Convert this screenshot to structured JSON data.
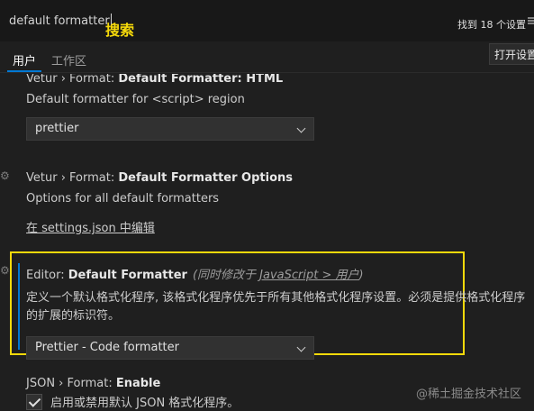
{
  "search": {
    "value": "default formatter",
    "annotation": "搜索",
    "result_count": "找到 18 个设置"
  },
  "tabs": [
    {
      "label": "用户",
      "active": true
    },
    {
      "label": "工作区",
      "active": false
    }
  ],
  "open_settings_label": "打开设置",
  "settings": [
    {
      "title_cat": "Vetur › Format: ",
      "title_name": "Default Formatter: HTML",
      "description": "Default formatter for <script> region",
      "value": "prettier"
    },
    {
      "title_cat": "Vetur › Format: ",
      "title_name": "Default Formatter Options",
      "description": "Options for all default formatters",
      "link": "在 settings.json 中编辑"
    },
    {
      "title_cat": "Editor: ",
      "title_name": "Default Formatter",
      "modified_prefix": "(同时修改于 ",
      "modified_link": "JavaScript > 用户",
      "modified_suffix": ")",
      "description": "定义一个默认格式化程序, 该格式化程序优先于所有其他格式化程序设置。必须是提供格式化程序的扩展的标识符。",
      "value": "Prettier - Code formatter"
    },
    {
      "title_cat": "JSON › Format: ",
      "title_name": "Enable",
      "checkbox_label": "启用或禁用默认 JSON 格式化程序。",
      "checked": true
    }
  ],
  "watermark": "@稀土掘金技术社区",
  "colors": {
    "accent": "#0078d4",
    "highlight": "#f5d90a",
    "background": "#1f1f1f"
  }
}
